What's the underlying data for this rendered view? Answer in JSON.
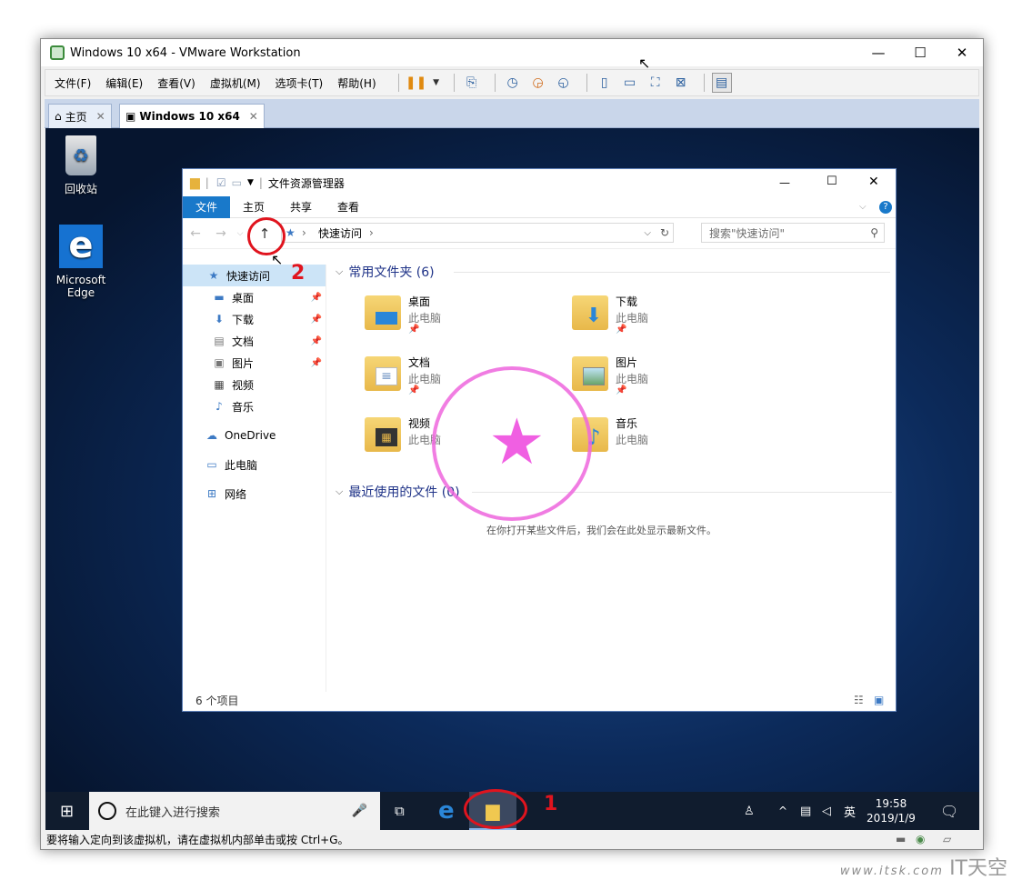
{
  "window": {
    "title": "Windows 10 x64 - VMware Workstation"
  },
  "menu": [
    "文件(F)",
    "编辑(E)",
    "查看(V)",
    "虚拟机(M)",
    "选项卡(T)",
    "帮助(H)"
  ],
  "tabs": [
    {
      "label": "主页"
    },
    {
      "label": "Windows 10 x64"
    }
  ],
  "desktop": {
    "recycle_bin": "回收站",
    "edge_line1": "Microsoft",
    "edge_line2": "Edge"
  },
  "explorer": {
    "title": "文件资源管理器",
    "ribbon": [
      "文件",
      "主页",
      "共享",
      "查看"
    ],
    "path": "快速访问",
    "search_placeholder": "搜索\"快速访问\"",
    "nav": {
      "quick_access": "快速访问",
      "items": [
        "桌面",
        "下载",
        "文档",
        "图片",
        "视频",
        "音乐"
      ],
      "onedrive": "OneDrive",
      "this_pc": "此电脑",
      "network": "网络"
    },
    "frequent_header": "常用文件夹 (6)",
    "folders": [
      {
        "name": "桌面",
        "sub": "此电脑"
      },
      {
        "name": "下载",
        "sub": "此电脑"
      },
      {
        "name": "文档",
        "sub": "此电脑"
      },
      {
        "name": "图片",
        "sub": "此电脑"
      },
      {
        "name": "视频",
        "sub": "此电脑"
      },
      {
        "name": "音乐",
        "sub": "此电脑"
      }
    ],
    "recent_header": "最近使用的文件 (0)",
    "recent_empty": "在你打开某些文件后，我们会在此处显示最新文件。",
    "status": "6 个项目"
  },
  "taskbar": {
    "search": "在此键入进行搜索",
    "ime": "英",
    "time": "19:58",
    "date": "2019/1/9"
  },
  "vm_status": "要将输入定向到该虚拟机，请在虚拟机内部单击或按 Ctrl+G。",
  "annotations": {
    "n1": "1",
    "n2": "2"
  },
  "watermark": {
    "url": "www.itsk.com",
    "brand": "IT天空"
  },
  "colors": {
    "accent": "#1979ca",
    "annotation": "#e0141e",
    "stamp": "#ee44dd"
  }
}
